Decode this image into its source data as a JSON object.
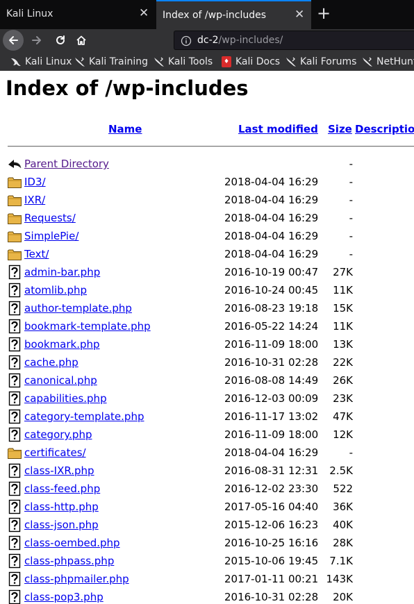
{
  "tabs": [
    {
      "title": "Kali Linux",
      "active": false
    },
    {
      "title": "Index of /wp-includes",
      "active": true
    }
  ],
  "address": {
    "host": "dc-2",
    "path": "/wp-includes/"
  },
  "bookmarks": [
    {
      "label": "Kali Linux",
      "icon": "kali-dragon-icon"
    },
    {
      "label": "Kali Training",
      "icon": "kali-dragon-icon"
    },
    {
      "label": "Kali Tools",
      "icon": "kali-dragon-icon"
    },
    {
      "label": "Kali Docs",
      "icon": "kali-docs-icon"
    },
    {
      "label": "Kali Forums",
      "icon": "kali-dragon-icon"
    },
    {
      "label": "NetHunt",
      "icon": "kali-dragon-icon"
    }
  ],
  "page": {
    "title": "Index of /wp-includes"
  },
  "table": {
    "headers": {
      "name": "Name",
      "modified": "Last modified",
      "size": "Size",
      "description": "Description"
    },
    "rows": [
      {
        "icon": "back-icon",
        "name": "Parent Directory",
        "modified": "",
        "size": "-"
      },
      {
        "icon": "folder-icon",
        "name": "ID3/",
        "modified": "2018-04-04 16:29",
        "size": "-"
      },
      {
        "icon": "folder-icon",
        "name": "IXR/",
        "modified": "2018-04-04 16:29",
        "size": "-"
      },
      {
        "icon": "folder-icon",
        "name": "Requests/",
        "modified": "2018-04-04 16:29",
        "size": "-"
      },
      {
        "icon": "folder-icon",
        "name": "SimplePie/",
        "modified": "2018-04-04 16:29",
        "size": "-"
      },
      {
        "icon": "folder-icon",
        "name": "Text/",
        "modified": "2018-04-04 16:29",
        "size": "-"
      },
      {
        "icon": "unknown-file-icon",
        "name": "admin-bar.php",
        "modified": "2016-10-19 00:47",
        "size": "27K"
      },
      {
        "icon": "unknown-file-icon",
        "name": "atomlib.php",
        "modified": "2016-10-24 00:45",
        "size": "11K"
      },
      {
        "icon": "unknown-file-icon",
        "name": "author-template.php",
        "modified": "2016-08-23 19:18",
        "size": "15K"
      },
      {
        "icon": "unknown-file-icon",
        "name": "bookmark-template.php",
        "modified": "2016-05-22 14:24",
        "size": "11K"
      },
      {
        "icon": "unknown-file-icon",
        "name": "bookmark.php",
        "modified": "2016-11-09 18:00",
        "size": "13K"
      },
      {
        "icon": "unknown-file-icon",
        "name": "cache.php",
        "modified": "2016-10-31 02:28",
        "size": "22K"
      },
      {
        "icon": "unknown-file-icon",
        "name": "canonical.php",
        "modified": "2016-08-08 14:49",
        "size": "26K"
      },
      {
        "icon": "unknown-file-icon",
        "name": "capabilities.php",
        "modified": "2016-12-03 00:09",
        "size": "23K"
      },
      {
        "icon": "unknown-file-icon",
        "name": "category-template.php",
        "modified": "2016-11-17 13:02",
        "size": "47K"
      },
      {
        "icon": "unknown-file-icon",
        "name": "category.php",
        "modified": "2016-11-09 18:00",
        "size": "12K"
      },
      {
        "icon": "folder-icon",
        "name": "certificates/",
        "modified": "2018-04-04 16:29",
        "size": "-"
      },
      {
        "icon": "unknown-file-icon",
        "name": "class-IXR.php",
        "modified": "2016-08-31 12:31",
        "size": "2.5K"
      },
      {
        "icon": "unknown-file-icon",
        "name": "class-feed.php",
        "modified": "2016-12-02 23:30",
        "size": "522"
      },
      {
        "icon": "unknown-file-icon",
        "name": "class-http.php",
        "modified": "2017-05-16 04:40",
        "size": "36K"
      },
      {
        "icon": "unknown-file-icon",
        "name": "class-json.php",
        "modified": "2015-12-06 16:23",
        "size": "40K"
      },
      {
        "icon": "unknown-file-icon",
        "name": "class-oembed.php",
        "modified": "2016-10-25 16:16",
        "size": "28K"
      },
      {
        "icon": "unknown-file-icon",
        "name": "class-phpass.php",
        "modified": "2015-10-06 19:45",
        "size": "7.1K"
      },
      {
        "icon": "unknown-file-icon",
        "name": "class-phpmailer.php",
        "modified": "2017-01-11 00:21",
        "size": "143K"
      },
      {
        "icon": "unknown-file-icon",
        "name": "class-pop3.php",
        "modified": "2016-10-31 02:28",
        "size": "20K"
      }
    ]
  },
  "colors": {
    "link": "#0000ee",
    "visited": "#551a8b",
    "tab_accent": "#0a84ff",
    "chrome_dark": "#0c0c0d",
    "chrome": "#323234"
  }
}
